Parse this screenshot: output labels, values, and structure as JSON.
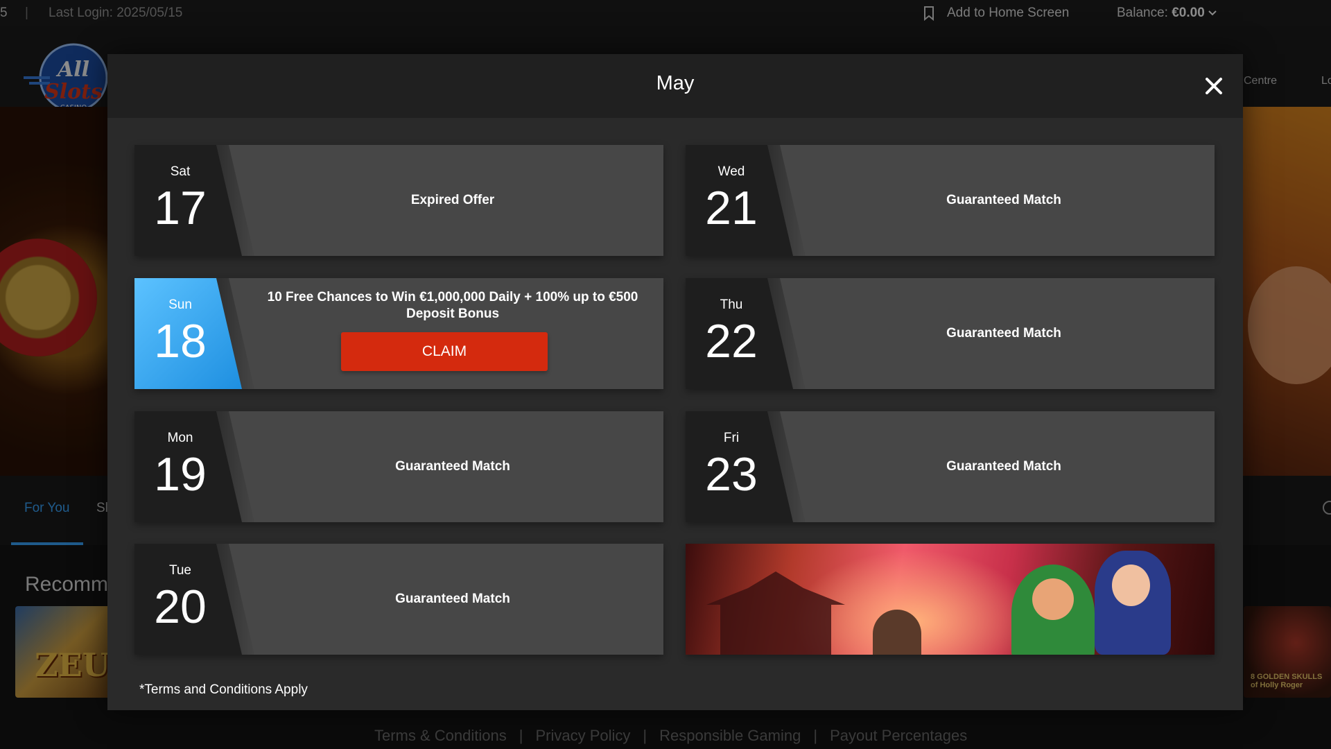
{
  "topbar": {
    "cut_char": "5",
    "separator": "|",
    "last_login": "Last Login: 2025/05/15",
    "add_to_home": "Add to Home Screen",
    "balance_label": "Balance:",
    "balance_value": "€0.00"
  },
  "header": {
    "nav_partial_1": "Centre",
    "nav_partial_2": "Lo"
  },
  "background": {
    "tab_for_you": "For You",
    "tab_partial": "Sl",
    "section_title_partial": "Recomm",
    "thumb_left_text": "ZEUS",
    "thumb_right_text": "8 GOLDEN SKULLS of Holly Roger",
    "footer_links": [
      "Terms & Conditions",
      "Privacy Policy",
      "Responsible Gaming",
      "Payout Percentages"
    ],
    "footer_sep": "|"
  },
  "modal": {
    "title": "May",
    "terms_note": "*Terms and Conditions Apply",
    "days": [
      {
        "dow": "Sat",
        "day": "17",
        "label": "Expired Offer"
      },
      {
        "dow": "Wed",
        "day": "21",
        "label": "Guaranteed Match"
      },
      {
        "dow": "Sun",
        "day": "18",
        "label": "10 Free Chances to Win €1,000,000 Daily + 100% up to €500 Deposit Bonus",
        "button": "CLAIM"
      },
      {
        "dow": "Thu",
        "day": "22",
        "label": "Guaranteed Match"
      },
      {
        "dow": "Mon",
        "day": "19",
        "label": "Guaranteed Match"
      },
      {
        "dow": "Fri",
        "day": "23",
        "label": "Guaranteed Match"
      },
      {
        "dow": "Tue",
        "day": "20",
        "label": "Guaranteed Match"
      }
    ]
  },
  "colors": {
    "accent_blue": "#3aa6ff",
    "claim_red": "#d42a0e",
    "active_day_blue": "#2a9ff0"
  },
  "icons": [
    "bookmark-icon",
    "chevron-down-icon",
    "close-icon",
    "search-icon"
  ]
}
